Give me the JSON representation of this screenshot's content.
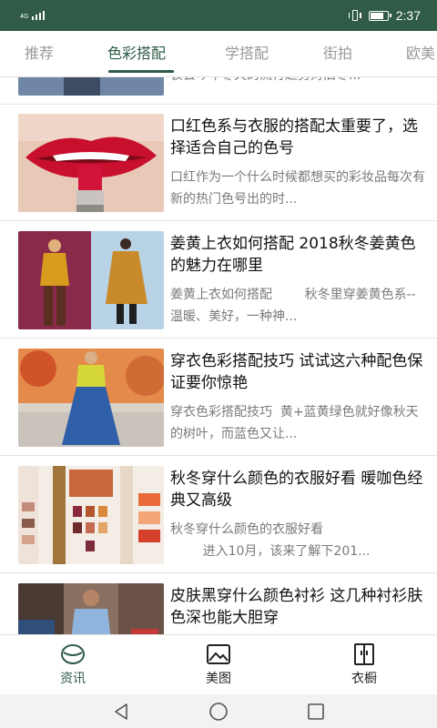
{
  "status_bar": {
    "network_label": "4G",
    "time": "2:37",
    "battery_level": 0.85
  },
  "tabs": [
    {
      "label": "推荐",
      "active": false
    },
    {
      "label": "色彩搭配",
      "active": true
    },
    {
      "label": "学搭配",
      "active": false
    },
    {
      "label": "街拍",
      "active": false
    },
    {
      "label": "欧美",
      "active": false
    }
  ],
  "partial_item": {
    "desc": "该会今年冬天的流行趋势对旧冬..."
  },
  "articles": [
    {
      "title": "口红色系与衣服的搭配太重要了，选择适合自己的色号",
      "desc": "口红作为一个什么时候都想买的彩妆品每次有新的热门色号出的时...",
      "image": "lipstick-photo"
    },
    {
      "title": "姜黄上衣如何搭配 2018秋冬姜黄色的魅力在哪里",
      "desc": "姜黄上衣如何搭配        秋冬里穿姜黄色系--温暖、美好，一种神...",
      "image": "mustard-outfit-photo"
    },
    {
      "title": "穿衣色彩搭配技巧 试试这六种配色保证要你惊艳",
      "desc": "穿衣色彩搭配技巧  黄+蓝黄绿色就好像秋天的树叶，而蓝色又让...",
      "image": "yellow-blue-outfit-photo"
    },
    {
      "title": "秋冬穿什么颜色的衣服好看 暖咖色经典又高级",
      "desc": "秋冬穿什么颜色的衣服好看\n        进入10月，该来了解下201...",
      "image": "color-palette-photo"
    },
    {
      "title": "皮肤黑穿什么颜色衬衫 这几种衬衫肤色深也能大胆穿",
      "desc": "",
      "image": "street-shirt-photo"
    }
  ],
  "bottom_nav": [
    {
      "label": "资讯",
      "icon": "news-icon",
      "active": true
    },
    {
      "label": "美图",
      "icon": "picture-icon",
      "active": false
    },
    {
      "label": "衣橱",
      "icon": "wardrobe-icon",
      "active": false
    }
  ],
  "colors": {
    "brand": "#2f5b47",
    "inactive_tab": "#9a9a9a"
  }
}
